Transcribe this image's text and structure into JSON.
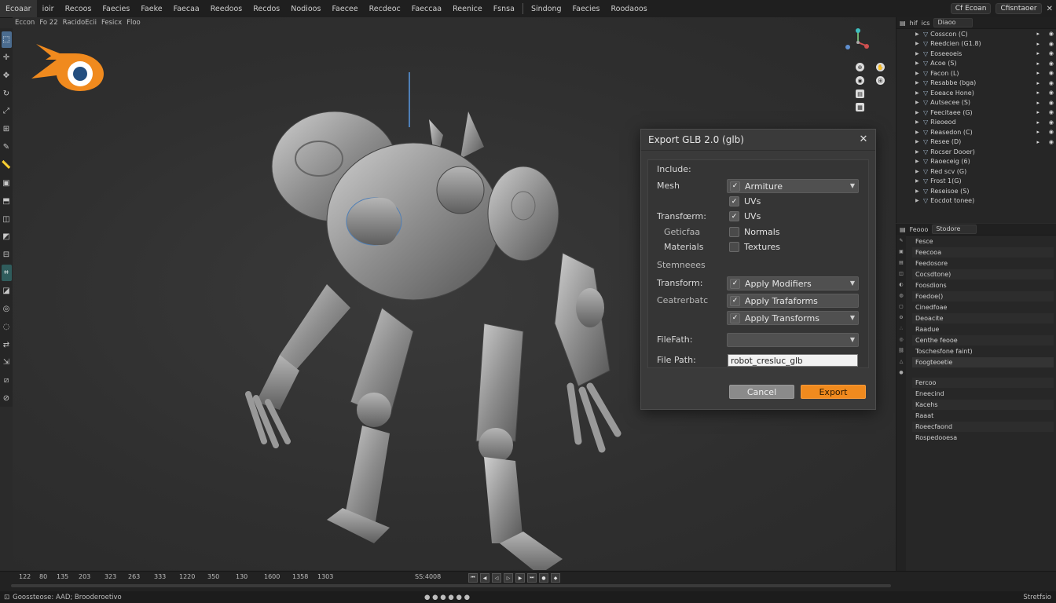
{
  "menu": {
    "items": [
      "Ecoaar",
      "ioir",
      "Recoos",
      "Faecies",
      "Faeke",
      "Faecaa",
      "Reedoos",
      "Recdos",
      "Nodioos",
      "Faecee",
      "Recdeoc",
      "Faeccaa",
      "Reenice",
      "Fsnsa",
      "Sindong",
      "Faecies",
      "Roodaoos"
    ],
    "right_scene": "Cf Ecoan",
    "right_view": "Cfisntaoer"
  },
  "viewport": {
    "header": [
      "Eccon",
      "Fo 22",
      "RacidoEcii",
      "Fesicx",
      "Floo"
    ]
  },
  "dialog": {
    "title": "Export GLB 2.0 (glb)",
    "close": "✕",
    "include_label": "Include:",
    "rows": {
      "mesh_label": "Mesh",
      "mesh_value": "Armiture",
      "uvs1": "UVs",
      "transform_label": "Transfœrm:",
      "uvs2": "UVs",
      "geometry_label": "Geticfaa",
      "normals": "Normals",
      "materials_label": "Materials",
      "textures": "Textures",
      "section_label": "Stemneees",
      "transform2_label": "Transform:",
      "apply_modifiers": "Apply Modifiers",
      "constraints_label": "Ceatrerbatc",
      "apply_trafaforms": "Apply Trafaforms",
      "apply_transforms": "Apply Transforms",
      "filepath1_label": "FileFath:",
      "filepath2_label": "File Path:",
      "filepath_value": "robot_cresluc_glb"
    },
    "cancel": "Cancel",
    "export": "Export"
  },
  "outliner": {
    "header_items": [
      "hif",
      "ics"
    ],
    "search": "Diaoo",
    "rows": [
      "Cosscon (C)",
      "Reedcien (G1.8)",
      "Eoseeoeis",
      "Acoe (S)",
      "Facon (L)",
      "Resabbe (bga)",
      "Eoeace Hone)",
      "Autsecee (S)",
      "Feecitaee (G)",
      "Rieoeod",
      "Reasedon (C)",
      "Resee (D)",
      "Rocser Dooer)",
      "Raoeceig (6)",
      "Red scv (G)",
      "Frost 1(G)",
      "Reseisoe (S)",
      "Eocdot tonee)"
    ]
  },
  "properties": {
    "tab_label": "Feooo",
    "search": "Stodore",
    "rows": [
      "Fesce",
      "Feecooa",
      "Feedosore",
      "Cocsdtone)",
      "Foosdions",
      "Foedoe()",
      "Cinedfoae",
      "Deoacite",
      "Raadue",
      "Centhe feooe",
      "Toschesfone faint)",
      "Foogteoetie",
      "Fercoo",
      "Eneecind",
      "Kacehs",
      "Raaat",
      "Roeecfaond",
      "Rospedooesa"
    ]
  },
  "timeline": {
    "numbers": [
      "122",
      "80",
      "135",
      "203",
      "323",
      "263",
      "333",
      "1220",
      "350",
      "130",
      "1600",
      "1358",
      "1303",
      "SS:4008"
    ]
  },
  "status": {
    "left": "Goossteose: AAD; Brooderoetivo",
    "right": "Stretfsio"
  },
  "colors": {
    "accent_orange": "#f08a1e",
    "logo_blue": "#234e7f",
    "selection_blue": "#4b6c8f"
  }
}
